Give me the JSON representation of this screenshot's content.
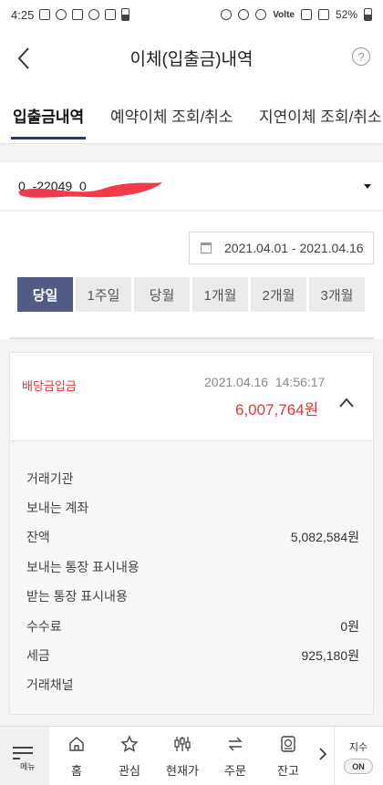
{
  "status_bar": {
    "time": "4:25",
    "network": "Volte",
    "battery": "52%"
  },
  "header": {
    "title": "이체(입출금)내역",
    "help": "?"
  },
  "tabs": [
    {
      "label": "입출금내역",
      "active": true
    },
    {
      "label": "예약이체 조회/취소",
      "active": false
    },
    {
      "label": "지연이체 조회/취소",
      "active": false
    }
  ],
  "account": {
    "number": "0_-22049_0"
  },
  "filter": {
    "date_range": "2021.04.01 - 2021.04.16",
    "periods": [
      {
        "label": "당일",
        "active": true
      },
      {
        "label": "1주일",
        "active": false
      },
      {
        "label": "당월",
        "active": false
      },
      {
        "label": "1개월",
        "active": false
      },
      {
        "label": "2개월",
        "active": false
      },
      {
        "label": "3개월",
        "active": false
      }
    ]
  },
  "transaction": {
    "type": "배당금입금",
    "date": "2021.04.16",
    "time": "14:56:17",
    "amount": "6,007,764원",
    "details": [
      {
        "label": "거래기관",
        "value": ""
      },
      {
        "label": "보내는 계좌",
        "value": ""
      },
      {
        "label": "잔액",
        "value": "5,082,584원"
      },
      {
        "label": "보내는 통장 표시내용",
        "value": ""
      },
      {
        "label": "받는 통장 표시내용",
        "value": ""
      },
      {
        "label": "수수료",
        "value": "0원"
      },
      {
        "label": "세금",
        "value": "925,180원"
      },
      {
        "label": "거래채널",
        "value": ""
      }
    ]
  },
  "bottom_nav": {
    "menu_label": "메뉴",
    "items": [
      {
        "label": "홈",
        "icon": "home-icon"
      },
      {
        "label": "관심",
        "icon": "star-icon"
      },
      {
        "label": "현재가",
        "icon": "price-icon"
      },
      {
        "label": "주문",
        "icon": "order-icon"
      },
      {
        "label": "잔고",
        "icon": "balance-icon"
      }
    ],
    "index_label": "지수",
    "index_toggle": "ON"
  },
  "colors": {
    "accent": "#525a86",
    "amount": "#d83a3a",
    "tab_underline": "#2d3a5e"
  }
}
